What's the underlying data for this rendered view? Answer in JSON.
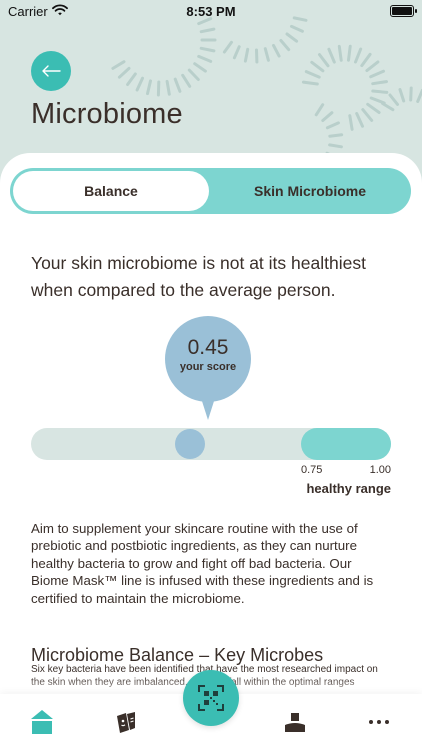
{
  "status_bar": {
    "carrier": "Carrier",
    "time": "8:53 PM"
  },
  "header": {
    "title": "Microbiome",
    "back_icon": "back-arrow-icon"
  },
  "segments": {
    "balance_label": "Balance",
    "skin_label": "Skin Microbiome",
    "selected": "Balance"
  },
  "score_section": {
    "headline": "Your skin microbiome is not at its healthiest when compared to the average person.",
    "score_value": "0.45",
    "score_label": "your score",
    "score": 0.45,
    "healthy_range_min": 0.75,
    "healthy_range_max": 1.0,
    "range_min_label": "0.75",
    "range_max_label": "1.00",
    "range_label": "healthy range"
  },
  "advice": {
    "text": "Aim to supplement your skincare routine with the use of prebiotic and postbiotic ingredients, as they can nurture healthy bacteria to grow and fight off bad bacteria. Our Biome Mask™ line is infused with these ingredients and is certified to maintain the microbiome."
  },
  "key_microbes": {
    "title": "Microbiome Balance – Key Microbes",
    "text": "Six key bacteria have been identified that have the most researched impact on the skin when they are imbalanced. ... tial to fall within the optimal ranges"
  },
  "tab_bar": {
    "items": [
      {
        "icon": "home-icon",
        "active": true
      },
      {
        "icon": "products-icon",
        "active": false
      },
      {
        "icon": "scan-icon",
        "active": false
      },
      {
        "icon": "profile-icon",
        "active": false
      },
      {
        "icon": "more-icon",
        "active": false
      }
    ]
  },
  "colors": {
    "accent": "#3bbdb3",
    "segment_bg": "#7dd5d0",
    "score": "#9ac0d7",
    "hero_bg": "#d7e5e1",
    "text": "#3a2f2a"
  }
}
